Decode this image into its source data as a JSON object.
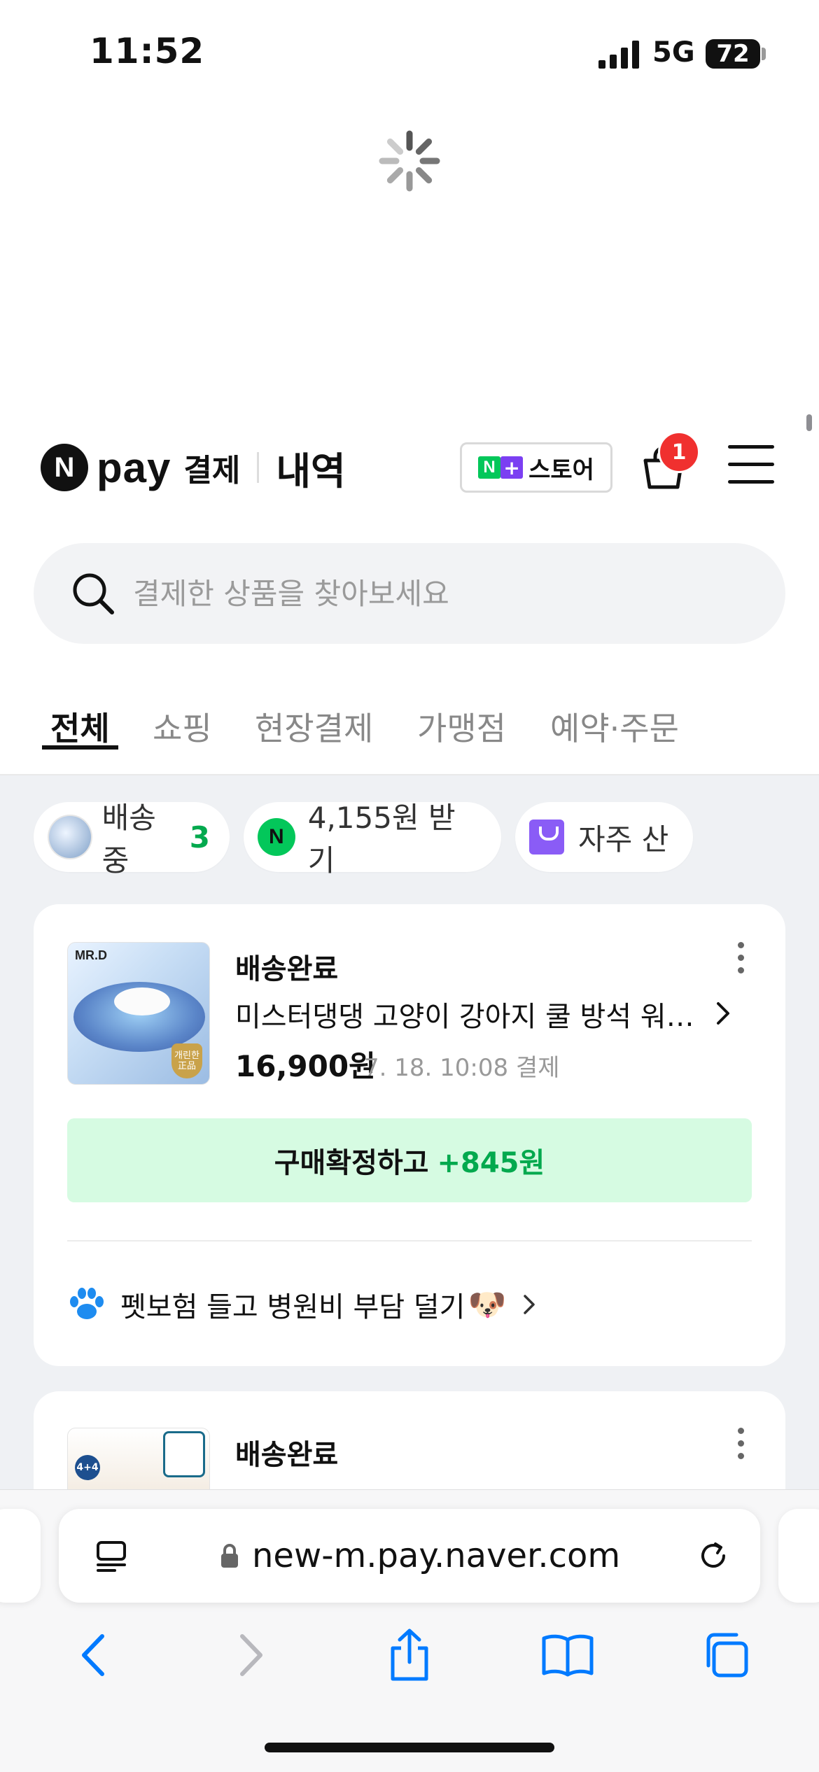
{
  "status_bar": {
    "time": "11:52",
    "network": "5G",
    "battery": "72"
  },
  "header": {
    "brand_n": "N",
    "brand_pay": "pay",
    "brand_sub": "결제",
    "brand_title": "내역",
    "store_n": "N",
    "store_plus": "+",
    "store_label": "스토어",
    "cart_badge": "1"
  },
  "search": {
    "placeholder": "결제한 상품을 찾아보세요"
  },
  "tabs": [
    {
      "label": "전체",
      "active": true
    },
    {
      "label": "쇼핑"
    },
    {
      "label": "현장결제"
    },
    {
      "label": "가맹점"
    },
    {
      "label": "예약·주문"
    }
  ],
  "chips": [
    {
      "label": "배송중",
      "count": "3"
    },
    {
      "icon_text": "N",
      "label": "4,155원 받기"
    },
    {
      "label": "자주 산"
    }
  ],
  "orders": [
    {
      "status": "배송완료",
      "image_logo": "MR.D",
      "image_badge": "개린한 正品",
      "title": "미스터댕댕 고양이 강아지 쿨 방석 워터 매트",
      "price": "16,900원",
      "date": "7. 18. 10:08 결제",
      "confirm_label": "구매확정하고",
      "confirm_amount": "+845원",
      "promo": "펫보험 들고 병원비 부담 덜기",
      "promo_emoji": "🐶"
    },
    {
      "status": "배송완료",
      "image_tag": "4+4"
    }
  ],
  "browser": {
    "url": "new-m.pay.naver.com"
  },
  "colors": {
    "naver_green": "#03c75a",
    "confirm_bg": "#d6fbe2",
    "badge_red": "#f0302f",
    "safari_blue": "#007aff"
  }
}
